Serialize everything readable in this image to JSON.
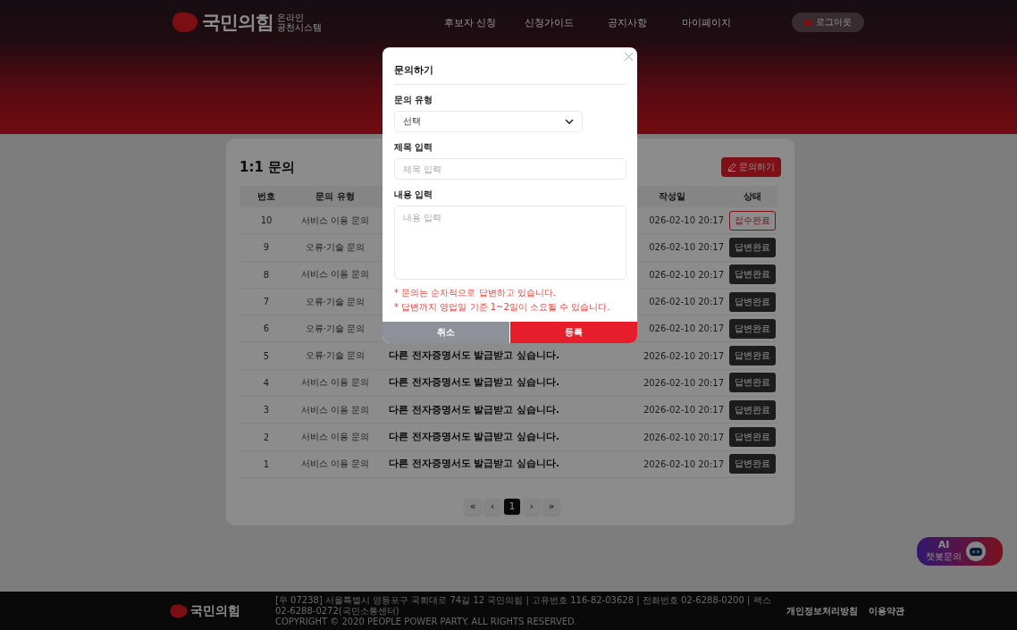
{
  "header": {
    "logo_text": "국민의힘",
    "logo_subtitle": [
      "온라인",
      "공천시스템"
    ],
    "nav": [
      {
        "label": "후보자 신청"
      },
      {
        "label": "신청가이드"
      },
      {
        "label": "공지사항"
      },
      {
        "label": "마이페이지"
      }
    ],
    "auth_button": "로그아웃"
  },
  "inquiry": {
    "title": "1:1 문의",
    "write_button": "문의하기",
    "columns": [
      "번호",
      "문의 유형",
      "",
      "작성일",
      "상태"
    ],
    "rows": [
      {
        "number": "10",
        "type": "서비스 이용 문의",
        "date": "026-02-10 20:17",
        "status": "접수완료",
        "kind": "received"
      },
      {
        "number": "9",
        "type": "오류·기술 문의",
        "date": "026-02-10 20:17",
        "status": "답변완료",
        "kind": "answered"
      },
      {
        "number": "8",
        "type": "서비스 이용 문의",
        "date": "026-02-10 20:17",
        "status": "답변완료",
        "kind": "answered"
      },
      {
        "number": "7",
        "type": "오류·기술 문의",
        "date": "026-02-10 20:17",
        "status": "답변완료",
        "kind": "answered"
      },
      {
        "number": "6",
        "type": "오류·기술 문의",
        "date": "026-02-10 20:17",
        "status": "답변완료",
        "kind": "answered"
      },
      {
        "number": "5",
        "type": "오류·기술 문의",
        "title": "다른 전자증명서도 발급받고 싶습니다.",
        "date": "2026-02-10 20:17",
        "status": "답변완료",
        "kind": "answered"
      },
      {
        "number": "4",
        "type": "서비스 이용 문의",
        "title": "다른 전자증명서도 발급받고 싶습니다.",
        "date": "2026-02-10 20:17",
        "status": "답변완료",
        "kind": "answered"
      },
      {
        "number": "3",
        "type": "서비스 이용 문의",
        "title": "다른 전자증명서도 발급받고 싶습니다.",
        "date": "2026-02-10 20:17",
        "status": "답변완료",
        "kind": "answered"
      },
      {
        "number": "2",
        "type": "서비스 이용 문의",
        "title": "다른 전자증명서도 발급받고 싶습니다.",
        "date": "2026-02-10 20:17",
        "status": "답변완료",
        "kind": "answered"
      },
      {
        "number": "1",
        "type": "서비스 이용 문의",
        "title": "다른 전자증명서도 발급받고 싶습니다.",
        "date": "2026-02-10 20:17",
        "status": "답변완료",
        "kind": "answered"
      }
    ],
    "pagination": {
      "first": "«",
      "prev": "‹",
      "pages": [
        {
          "label": "1",
          "selected": true
        }
      ],
      "next": "›",
      "last": "»"
    }
  },
  "modal": {
    "title": "문의하기",
    "fields": [
      {
        "kind": "select",
        "label": "문의 유형",
        "value": "선택"
      },
      {
        "kind": "input",
        "label": "제목 입력",
        "placeholder": "제목 입력"
      },
      {
        "kind": "textarea",
        "label": "내용 입력",
        "placeholder": "내용 입력"
      }
    ],
    "notes": [
      "* 문의는 순차적으로 답변하고 있습니다.",
      "* 답변까지 영업일 기준 1~2일이 소요될 수 있습니다."
    ],
    "buttons": [
      {
        "kind": "cancel",
        "label": "취소"
      },
      {
        "kind": "submit",
        "label": "등록"
      }
    ]
  },
  "footer": {
    "logo_text": "국민의힘",
    "address": "[우 07238] 서울특별시 영등포구 국회대로 74길 12 국민의힘 | 고유번호 116-82-03628 | 전화번호 02-6288-0200 | 팩스 02-6288-0272(국민소통센터)",
    "copyright": "COPYRIGHT © 2020 PEOPLE POWER PARTY. ALL RIGHTS RESERVED.",
    "links": [
      "개인정보처리방침",
      "이용약관"
    ]
  },
  "ai_button": {
    "title": "AI",
    "subtitle": "챗봇문의"
  }
}
